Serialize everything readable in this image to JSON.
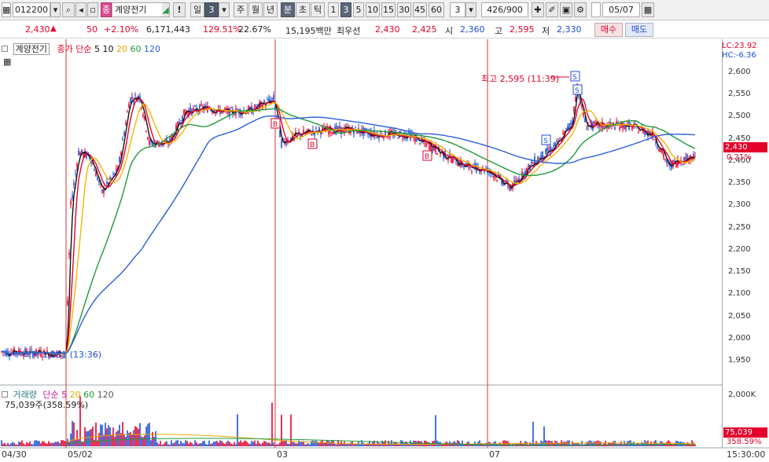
{
  "toolbar": {
    "code": "012200",
    "name": "계양전기",
    "bang": "!",
    "periods": [
      "일",
      "3",
      "주",
      "월",
      "년",
      "분",
      "초",
      "틱",
      "1",
      "3",
      "5",
      "10",
      "15",
      "30",
      "45",
      "60"
    ],
    "interval_value": "3",
    "count": "426/900",
    "date": "05/07"
  },
  "quote": {
    "price": "2,430",
    "arrow": "▲",
    "change": "50",
    "pct": "+2.10%",
    "volume": "6,171,443",
    "vol_ratio": "129.51%",
    "turnover_pct": "22.67%",
    "amount": "15,195백만",
    "best_label": "최우선",
    "ask": "2,430",
    "bid": "2,425",
    "open_label": "시",
    "open": "2,360",
    "high_label": "고",
    "high": "2,595",
    "low_label": "저",
    "low": "2,330",
    "buy_label": "매수",
    "sell_label": "매도"
  },
  "price_legend": {
    "name": "계양전기",
    "prefix": "종가 단순",
    "ma": [
      "5",
      "10",
      "20",
      "60",
      "120"
    ]
  },
  "lc_hc": {
    "lc": "LC:23.92",
    "hc": "HC:-6.36"
  },
  "y_ticks": [
    "2,600",
    "2,550",
    "2,500",
    "2,450",
    "2,400",
    "2,350",
    "2,300",
    "2,250",
    "2,200",
    "2,150",
    "2,100",
    "2,050",
    "2,000",
    "1,950"
  ],
  "last_price_tag": "2,430",
  "last_pct_tag": "0.21%",
  "annotations": {
    "high": "최고 2,595 (11:39)",
    "low": "최저 1,961 (13:36)"
  },
  "volume_legend": {
    "name": "거래량",
    "prefix": "단순",
    "ma": [
      "5",
      "20",
      "60",
      "120"
    ],
    "value": "75,039주(358.59%)"
  },
  "vol_axis": {
    "tick": "2,000K",
    "tag": "75,039",
    "tag2": "358.59%"
  },
  "x_labels": [
    "04/30",
    "05/02",
    "03",
    "07"
  ],
  "time_label": "15:30:00",
  "colors": {
    "up": "#e4002b",
    "down": "#1d4ed8",
    "ma5": "#111111",
    "ma10": "#e4002b",
    "ma20": "#f2b705",
    "ma60": "#1f9a3a",
    "ma120": "#2b5fd9"
  }
}
